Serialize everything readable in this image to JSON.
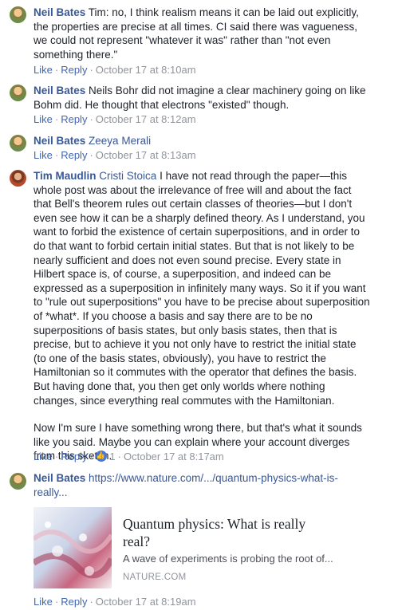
{
  "comments": [
    {
      "author": "Neil Bates",
      "mention": "",
      "lines": [
        "Tim: no, I think realism means it can be laid out explicitly,",
        "the properties are precise at all times. CI said there was vagueness,",
        "we could not represent \"whatever it was\" rather than \"not even",
        "something there.\""
      ],
      "like": "Like",
      "reply": "Reply",
      "time": "October 17 at 8:10am"
    },
    {
      "author": "Neil Bates",
      "mention": "",
      "lines": [
        "Neils Bohr did not imagine a clear machinery going on like",
        "Bohm did. He thought that electrons \"existed\" though."
      ],
      "like": "Like",
      "reply": "Reply",
      "time": "October 17 at 8:12am"
    },
    {
      "author": "Neil Bates",
      "mention": "Zeeya Merali",
      "lines": [],
      "like": "Like",
      "reply": "Reply",
      "time": "October 17 at 8:13am"
    },
    {
      "author": "Tim Maudlin",
      "mention": "Cristi Stoica",
      "lines": [
        "I have not read through the paper—this",
        "whole post was about the irrelevance of free will and about the fact",
        "that Bell's theorem rules out certain classes of theories—but I don't",
        "even see how it can be a sharply defined theory. As I understand, you",
        "want to forbid the existence of certain superpositions, and in order to",
        "do that want to forbid certain initial states. But that is not likely to be",
        "nearly sufficient and does not even sound precise. Every state in",
        "Hilbert space is, of course, a superposition, and indeed can be",
        "expressed as a superposition in infinitely many ways. So it if you want",
        "to \"rule out superpositions\" you have to be precise about superposition",
        "of *what*. If you choose a basis and say there are to be no",
        "superpositions of basis states, but only basis states, then that is",
        "precise, but to achieve it you not only have to restrict the initial state",
        "(to one of the basis states, obviously), you have to restrict the",
        "Hamiltonian so it commutes with the operator that defines the basis.",
        "But having done that, you then get only worlds where nothing",
        "changes, since everything real commutes with the Hamiltonian."
      ],
      "lines2": [
        "Now I'm sure I have something wrong there, but that's what it sounds",
        "like you said. Maybe you can explain where your account diverges",
        "from this sketch."
      ],
      "like": "Like",
      "reply": "Reply",
      "reactions": "1",
      "time": "October 17 at 8:17am"
    },
    {
      "author": "Neil Bates",
      "mention": "",
      "link_lines": [
        "https://www.nature.com/.../quantum-physics-what-is-",
        "really..."
      ],
      "like": "Like",
      "reply": "Reply",
      "time": "October 17 at 8:19am"
    }
  ],
  "preview": {
    "title_lines": [
      "Quantum physics: What is really",
      "real?"
    ],
    "description": "A wave of experiments is probing the root of...",
    "domain": "NATURE.COM"
  }
}
